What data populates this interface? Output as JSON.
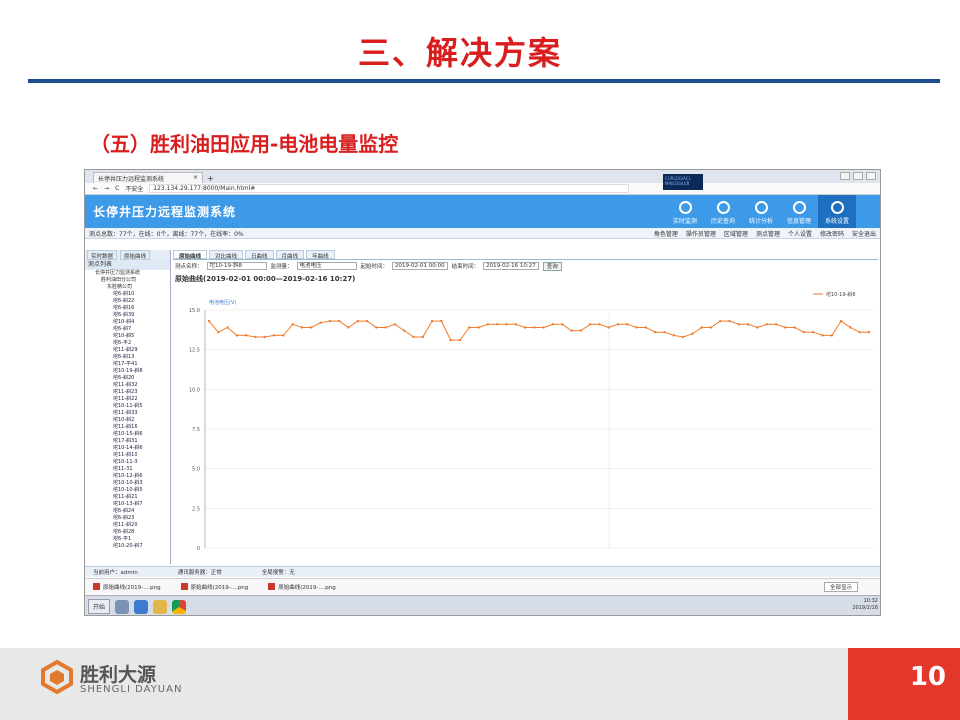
{
  "slide": {
    "title": "三、解决方案",
    "subtitle": "（五）胜利油田应用-电池电量监控",
    "page_number": "10",
    "logo_text_cn": "胜利大源",
    "logo_text_en": "SHENGLI DAYUAN"
  },
  "browser": {
    "tab_title": "长停井压力远程监测系统",
    "security_label": "不安全",
    "url": "123.134.29.177:8000/Main.html#",
    "overlay_text": "CURLOG/ACL MAILOG/LVB"
  },
  "app": {
    "title": "长停井压力远程监测系统",
    "nav": [
      {
        "label": "实时监测",
        "icon": "clock-icon"
      },
      {
        "label": "历史查询",
        "icon": "search-icon"
      },
      {
        "label": "统计分析",
        "icon": "chart-icon"
      },
      {
        "label": "信息管理",
        "icon": "document-icon"
      },
      {
        "label": "系统设置",
        "icon": "gear-icon"
      }
    ],
    "stats_text": "测点总数：77个，在线：0个，离线：77个，在线率：0%",
    "toolbar_links": [
      "角色管理",
      "操作员管理",
      "区域管理",
      "测点管理",
      "个人设置"
    ],
    "right_links": [
      "修改密码",
      "安全退出"
    ]
  },
  "sidebar": {
    "tabs": [
      "实时数据",
      "原始曲线"
    ],
    "header": "测点列表",
    "tree_root": "长停井压力监测系统",
    "tree_company": "胜利油田分公司",
    "tree_unit": "东胜精公司",
    "wells": [
      "坨6-斜10",
      "坨6-斜22",
      "坨6-斜16",
      "坨6-斜39",
      "坨10-斜4",
      "坨6-斜7",
      "坨10-斜5",
      "坨6-平2",
      "坨11-斜29",
      "坨6-斜13",
      "坨17-平41",
      "坨10-19-斜8",
      "坨6-斜20",
      "坨11-斜32",
      "坨11-斜23",
      "坨11-斜22",
      "坨10-11-斜5",
      "坨11-斜33",
      "坨10-斜2",
      "坨11-斜16",
      "坨10-15-斜6",
      "坨17-斜31",
      "坨10-14-斜6",
      "坨11-斜10",
      "坨10-11-3",
      "坨11-31",
      "坨10-12-斜6",
      "坨10-10-斜3",
      "坨10-10-斜5",
      "坨11-斜21",
      "坨10-13-斜7",
      "坨6-斜24",
      "坨6-斜23",
      "坨11-斜20",
      "坨6-斜28",
      "坨6-平1",
      "坨10-20-斜7"
    ]
  },
  "main": {
    "subtabs": [
      "原始曲线",
      "对比曲线",
      "日曲线",
      "月曲线",
      "年曲线"
    ],
    "query": {
      "point_label": "测点名称：",
      "point_value": "坨10-19-斜8",
      "metric_label": "监测量：",
      "metric_value": "电池电压",
      "start_label": "起始时间：",
      "start_value": "2019-02-01 00:00",
      "end_label": "结束时间：",
      "end_value": "2019-02-16 10:27",
      "button": "查询"
    }
  },
  "chart_data": {
    "type": "line",
    "title": "原始曲线(2019-02-01 00:00—2019-02-16 10:27)",
    "ylabel": "电池电压(V)",
    "ylim": [
      0,
      15
    ],
    "yticks": [
      0,
      2.5,
      5.0,
      7.5,
      10.0,
      12.5,
      15.0
    ],
    "ytick_labels": [
      "0",
      "2.5",
      "5.0",
      "7.5",
      "10.0",
      "12.5",
      "15.0"
    ],
    "grid": true,
    "legend_position": "top-right",
    "series": [
      {
        "name": "坨10-19-斜8",
        "color": "#f07d2d",
        "values": [
          14.3,
          13.6,
          13.9,
          13.4,
          13.4,
          13.3,
          13.3,
          13.4,
          13.4,
          14.1,
          13.9,
          13.9,
          14.2,
          14.3,
          14.3,
          13.9,
          14.3,
          14.3,
          13.9,
          13.9,
          14.1,
          13.7,
          13.3,
          13.3,
          14.3,
          14.3,
          13.1,
          13.1,
          13.9,
          13.9,
          14.1,
          14.1,
          14.1,
          14.1,
          13.9,
          13.9,
          13.9,
          14.1,
          14.1,
          13.7,
          13.7,
          14.1,
          14.1,
          13.9,
          14.1,
          14.1,
          13.9,
          13.9,
          13.6,
          13.6,
          13.4,
          13.3,
          13.5,
          13.9,
          13.9,
          14.3,
          14.3,
          14.1,
          14.1,
          13.9,
          14.1,
          14.1,
          13.9,
          13.9,
          13.6,
          13.6,
          13.4,
          13.4,
          14.3,
          13.9,
          13.6,
          13.6
        ]
      }
    ]
  },
  "footer": {
    "user": "当前用户：admin",
    "server": "通讯服务器：正常",
    "alarm": "全局报警：无"
  },
  "downloads": {
    "items": [
      "原始曲线(2019-....png",
      "原始曲线(2019-....png",
      "原始曲线(2019-....png"
    ],
    "show_all": "全部显示"
  },
  "taskbar": {
    "start": "开始",
    "clock_time": "10:32",
    "clock_date": "2019/2/16"
  }
}
